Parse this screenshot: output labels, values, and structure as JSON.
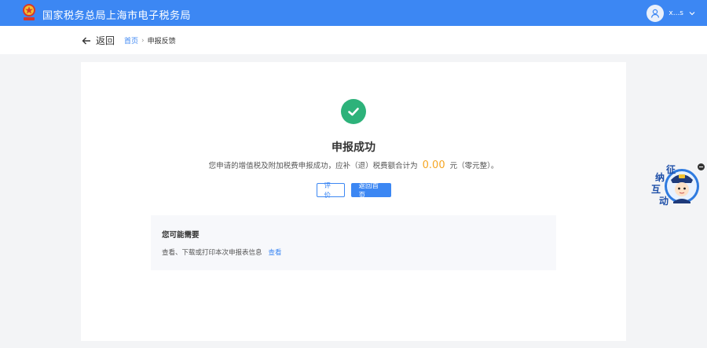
{
  "header": {
    "title": "国家税务总局上海市电子税务局",
    "username": "x...s",
    "logo_icon": "tax-emblem-icon",
    "avatar_icon": "user-avatar-icon",
    "dropdown_icon": "chevron-down-icon"
  },
  "subnav": {
    "back_label": "返回",
    "breadcrumb": {
      "home": "首页",
      "separator": "›",
      "current": "申报反馈"
    }
  },
  "result": {
    "title": "申报成功",
    "desc_prefix": "您申请的增值税及附加税费申报成功，应补（退）税费额合计为",
    "amount": "0.00",
    "desc_suffix": "元（零元整）。",
    "buttons": {
      "evaluate": "评价",
      "home": "返回首页"
    }
  },
  "maybe_need": {
    "title": "您可能需要",
    "line_text": "查看、下载或打印本次申报表信息",
    "link": "查看"
  },
  "assistant": {
    "chars": [
      "征",
      "纳",
      "互",
      "动"
    ]
  },
  "colors": {
    "primary": "#3c87f3",
    "success": "#2db27a",
    "amount": "#f5a623"
  }
}
